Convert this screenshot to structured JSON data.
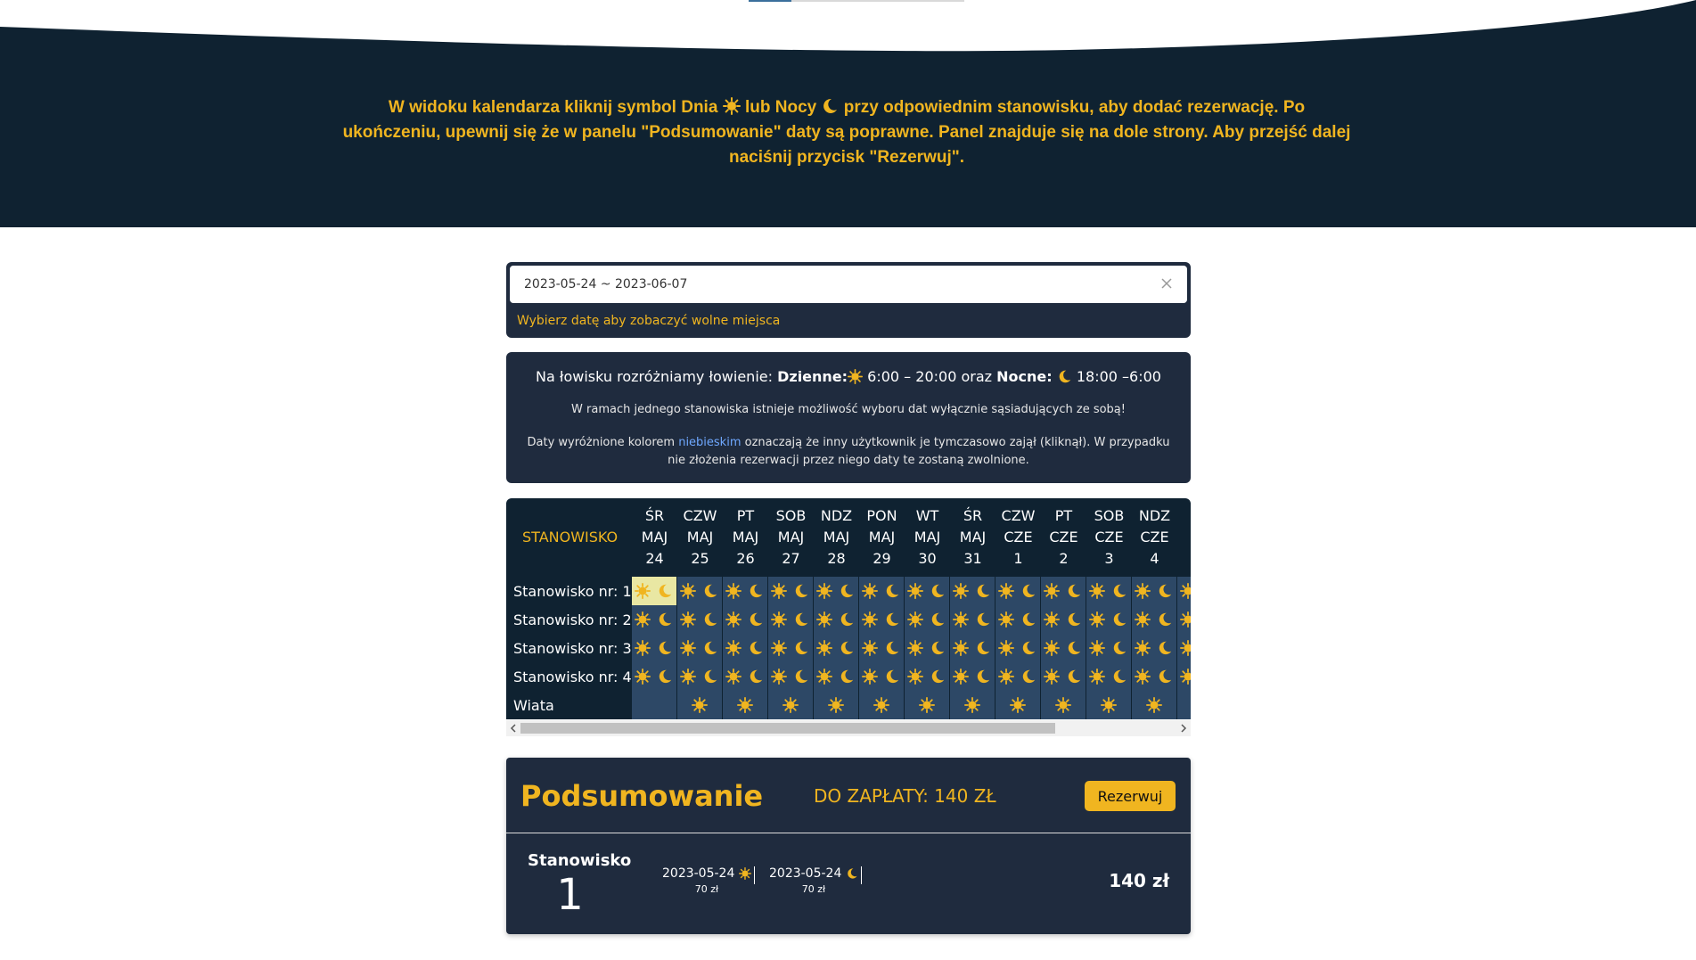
{
  "instructions": {
    "part1": "W widoku kalendarza kliknij symbol Dnia",
    "part2": "lub Nocy",
    "part3": "przy odpowiednim stanowisku, aby dodać rezerwację. Po ukończeniu, upewnij się że w panelu \"Podsumowanie\" daty są poprawne. Panel znajduje się na dole strony. Aby przejść dalej naciśnij przycisk \"Rezerwuj\"."
  },
  "date_picker": {
    "value": "2023-05-24 ~ 2023-06-07",
    "hint": "Wybierz datę aby zobaczyć wolne miejsca"
  },
  "info": {
    "line1_prefix": "Na łowisku rozróżniamy łowienie:",
    "line1_day_label": "Dzienne:",
    "line1_day_hours": "6:00 – 20:00 oraz",
    "line1_night_label": "Nocne:",
    "line1_night_hours": "18:00 –6:00",
    "line2": "W ramach jednego stanowiska istnieje możliwość wyboru dat wyłącznie sąsiadujących ze sobą!",
    "line3_prefix": "Daty wyróżnione kolorem",
    "line3_blue": "niebieskim",
    "line3_suffix": "oznaczają że inny użytkownik je tymczasowo zajął (kliknął). W przypadku nie złożenia rezerwacji przez niego daty te zostaną zwolnione."
  },
  "calendar": {
    "header_label": "STANOWISKO",
    "days": [
      {
        "dow": "ŚR",
        "mon": "MAJ",
        "day": "24"
      },
      {
        "dow": "CZW",
        "mon": "MAJ",
        "day": "25"
      },
      {
        "dow": "PT",
        "mon": "MAJ",
        "day": "26"
      },
      {
        "dow": "SOB",
        "mon": "MAJ",
        "day": "27"
      },
      {
        "dow": "NDZ",
        "mon": "MAJ",
        "day": "28"
      },
      {
        "dow": "PON",
        "mon": "MAJ",
        "day": "29"
      },
      {
        "dow": "WT",
        "mon": "MAJ",
        "day": "30"
      },
      {
        "dow": "ŚR",
        "mon": "MAJ",
        "day": "31"
      },
      {
        "dow": "CZW",
        "mon": "CZE",
        "day": "1"
      },
      {
        "dow": "PT",
        "mon": "CZE",
        "day": "2"
      },
      {
        "dow": "SOB",
        "mon": "CZE",
        "day": "3"
      },
      {
        "dow": "NDZ",
        "mon": "CZE",
        "day": "4"
      },
      {
        "dow": "P",
        "mon": "C",
        "day": ""
      }
    ],
    "rows": [
      {
        "label": "Stanowisko nr: 1",
        "type": "day-night",
        "selected_day": 0
      },
      {
        "label": "Stanowisko nr: 2",
        "type": "day-night"
      },
      {
        "label": "Stanowisko nr: 3",
        "type": "day-night"
      },
      {
        "label": "Stanowisko nr: 4",
        "type": "day-night"
      },
      {
        "label": "Wiata",
        "type": "day-only"
      }
    ]
  },
  "summary": {
    "title": "Podsumowanie",
    "due": "DO ZAPŁATY: 140 ZŁ",
    "button": "Rezerwuj",
    "stand_label": "Stanowisko",
    "stand_number": "1",
    "slots": [
      {
        "date": "2023-05-24",
        "kind": "day",
        "price": "70 zł"
      },
      {
        "date": "2023-05-24",
        "kind": "night",
        "price": "70 zł"
      }
    ],
    "total": "140 zł"
  },
  "colors": {
    "navy": "#0f2231",
    "panel": "#1f2b3e",
    "accent": "#f0b520",
    "cell": "#2d4866",
    "selected": "#e9e7a3"
  },
  "icons": {
    "day": "sun-icon",
    "night": "moon-icon",
    "clear": "close-icon"
  }
}
